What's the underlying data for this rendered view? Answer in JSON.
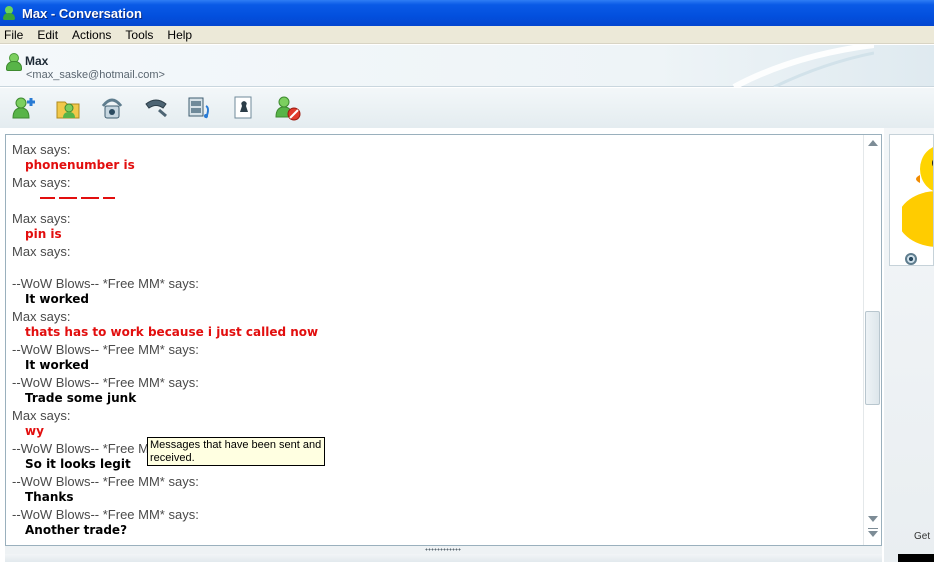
{
  "window": {
    "title": "Max - Conversation"
  },
  "menu": {
    "items": [
      "File",
      "Edit",
      "Actions",
      "Tools",
      "Help"
    ]
  },
  "contact": {
    "name": "Max",
    "email": "<max_saske@hotmail.com>"
  },
  "toolbar": {
    "icons": [
      "invite-contact-icon",
      "send-files-icon",
      "webcam-icon",
      "voice-call-icon",
      "video-clip-icon",
      "games-icon",
      "block-contact-icon"
    ]
  },
  "conversation": {
    "messages": [
      {
        "sender": "Max says:",
        "text": "phonenumber is",
        "from": "max"
      },
      {
        "sender": "Max says:",
        "text": "",
        "from": "max",
        "clipped": true
      },
      {
        "sender": "Max says:",
        "text": "pin is",
        "from": "max"
      },
      {
        "sender": "Max says:",
        "text": "",
        "from": "max",
        "clipped": true
      },
      {
        "sender": "--WoW Blows-- *Free MM* says:",
        "text": "It worked",
        "from": "other"
      },
      {
        "sender": "Max says:",
        "text": "thats has to work because i just called now",
        "from": "max"
      },
      {
        "sender": "--WoW Blows-- *Free MM* says:",
        "text": "It worked",
        "from": "other"
      },
      {
        "sender": "--WoW Blows-- *Free MM* says:",
        "text": "Trade some junk",
        "from": "other"
      },
      {
        "sender": "Max says:",
        "text": "wy",
        "from": "max"
      },
      {
        "sender": "--WoW Blows-- *Free MM* says:",
        "text": "So it looks legit",
        "from": "other"
      },
      {
        "sender": "--WoW Blows-- *Free MM* says:",
        "text": "Thanks",
        "from": "other"
      },
      {
        "sender": "--WoW Blows-- *Free MM* says:",
        "text": "Another trade?",
        "from": "other"
      }
    ]
  },
  "tooltip": {
    "text": "Messages that have been sent and received."
  },
  "right_pane": {
    "get_text": "Get"
  },
  "colors": {
    "titlebar": "#0350de",
    "max_text": "#e20e0e",
    "other_text": "#000000",
    "sender_text": "#4a4a4a",
    "tooltip_bg": "#ffffe1"
  }
}
